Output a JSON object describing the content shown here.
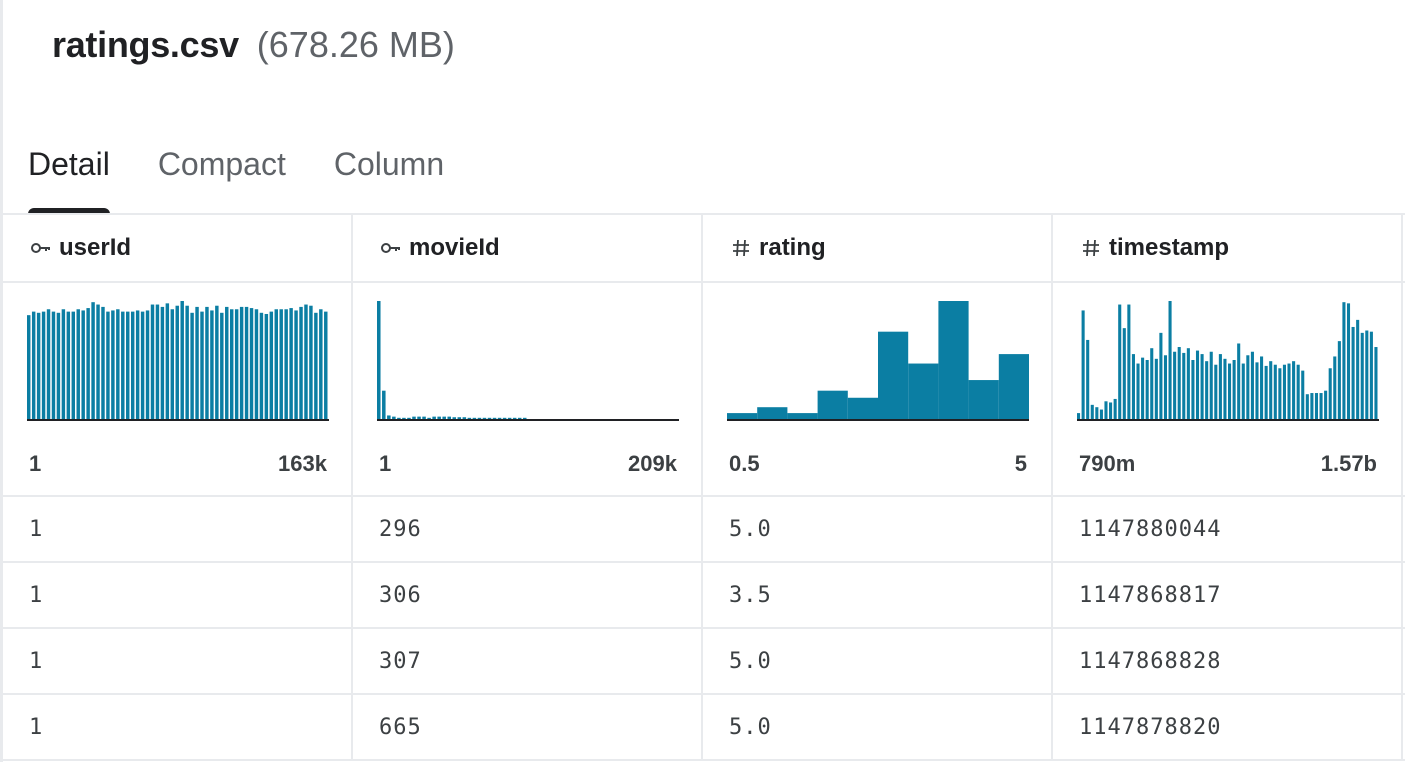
{
  "file": {
    "name": "ratings.csv",
    "size": "(678.26 MB)"
  },
  "tabs": [
    {
      "label": "Detail",
      "active": true
    },
    {
      "label": "Compact",
      "active": false
    },
    {
      "label": "Column",
      "active": false
    }
  ],
  "accent_color": "#0b7ea3",
  "columns": [
    {
      "name": "userId",
      "icon": "key-icon",
      "min": "1",
      "max": "163k",
      "bins": [
        0.88,
        0.91,
        0.9,
        0.91,
        0.93,
        0.91,
        0.9,
        0.93,
        0.91,
        0.91,
        0.93,
        0.92,
        0.94,
        0.99,
        0.97,
        0.95,
        0.91,
        0.92,
        0.93,
        0.91,
        0.91,
        0.91,
        0.92,
        0.91,
        0.92,
        0.97,
        0.97,
        0.95,
        0.98,
        0.93,
        0.96,
        1.0,
        0.96,
        0.9,
        0.95,
        0.91,
        0.95,
        0.92,
        0.96,
        0.9,
        0.95,
        0.93,
        0.93,
        0.95,
        0.95,
        0.94,
        0.93,
        0.9,
        0.89,
        0.91,
        0.93,
        0.93,
        0.93,
        0.94,
        0.92,
        0.95,
        0.97,
        0.96,
        0.9,
        0.93,
        0.91
      ]
    },
    {
      "name": "movieId",
      "icon": "key-icon",
      "min": "1",
      "max": "209k",
      "bins": [
        1.0,
        0.24,
        0.03,
        0.02,
        0.01,
        0.01,
        0.01,
        0.02,
        0.02,
        0.02,
        0.01,
        0.02,
        0.02,
        0.02,
        0.02,
        0.015,
        0.015,
        0.015,
        0.01,
        0.01,
        0.01,
        0.01,
        0.01,
        0.01,
        0.01,
        0.01,
        0.01,
        0.01,
        0.01,
        0.01,
        0.0,
        0.0,
        0.0,
        0.0,
        0.0,
        0.0,
        0.0,
        0.0,
        0.0,
        0.0,
        0.0,
        0.0,
        0.0,
        0.0,
        0.0,
        0.0,
        0.0,
        0.0,
        0.0,
        0.0,
        0.0,
        0.0,
        0.0,
        0.0,
        0.0,
        0.0,
        0.0,
        0.0,
        0.0,
        0.0
      ]
    },
    {
      "name": "rating",
      "icon": "hash-icon",
      "min": "0.5",
      "max": "5",
      "bins": [
        0.05,
        0.1,
        0.05,
        0.24,
        0.18,
        0.74,
        0.47,
        1.0,
        0.33,
        0.55
      ]
    },
    {
      "name": "timestamp",
      "icon": "hash-icon",
      "min": "790m",
      "max": "1.57b",
      "bins": [
        0.05,
        0.92,
        0.67,
        0.12,
        0.1,
        0.08,
        0.15,
        0.14,
        0.17,
        0.97,
        0.77,
        0.97,
        0.55,
        0.47,
        0.52,
        0.5,
        0.6,
        0.51,
        0.73,
        0.54,
        1.0,
        0.57,
        0.61,
        0.56,
        0.6,
        0.5,
        0.58,
        0.55,
        0.49,
        0.57,
        0.46,
        0.55,
        0.51,
        0.47,
        0.5,
        0.64,
        0.47,
        0.54,
        0.57,
        0.48,
        0.53,
        0.45,
        0.49,
        0.46,
        0.43,
        0.46,
        0.47,
        0.49,
        0.46,
        0.41,
        0.21,
        0.22,
        0.22,
        0.22,
        0.24,
        0.43,
        0.53,
        0.66,
        0.99,
        0.98,
        0.78,
        0.84,
        0.73,
        0.75,
        0.74,
        0.61
      ]
    }
  ],
  "rows": [
    [
      "1",
      "296",
      "5.0",
      "1147880044"
    ],
    [
      "1",
      "306",
      "3.5",
      "1147868817"
    ],
    [
      "1",
      "307",
      "5.0",
      "1147868828"
    ],
    [
      "1",
      "665",
      "5.0",
      "1147878820"
    ]
  ]
}
